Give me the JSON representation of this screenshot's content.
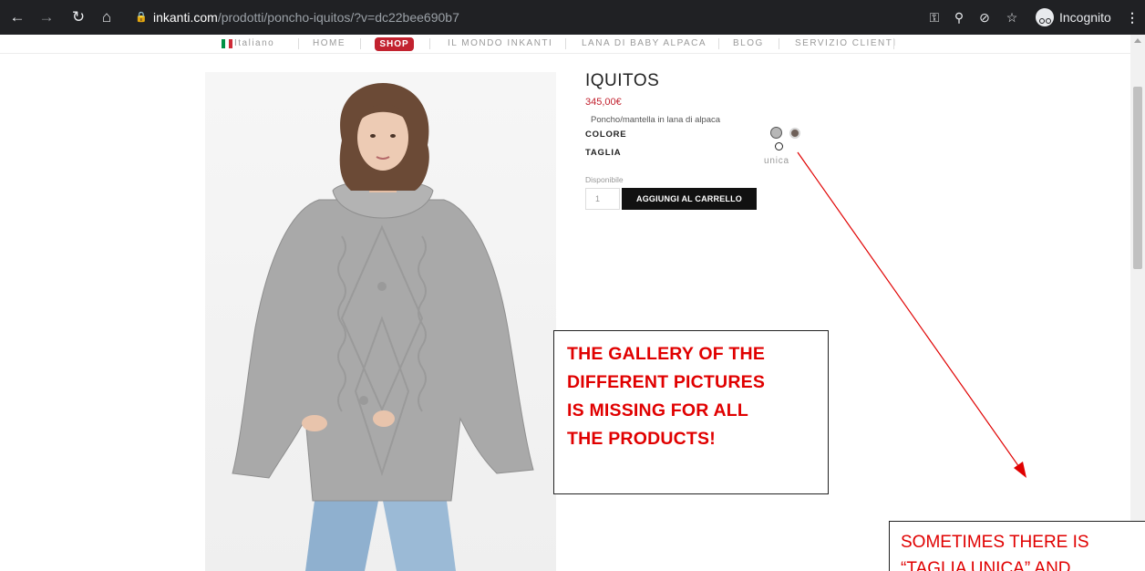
{
  "browser": {
    "url_domain": "inkanti.com",
    "url_path": "/prodotti/poncho-iquitos/?v=dc22bee690b7",
    "incognito_label": "Incognito",
    "icons": [
      "back-icon",
      "forward-icon",
      "reload-icon",
      "home-icon",
      "lock-icon",
      "key-icon",
      "zoom-icon",
      "eye-off-icon",
      "star-icon",
      "incognito-icon",
      "menu-icon"
    ]
  },
  "nav": {
    "language": "Italiano",
    "items": [
      "HOME",
      "SHOP",
      "IL MONDO INKANTI",
      "LANA DI BABY ALPACA",
      "BLOG",
      "SERVIZIO CLIENTI"
    ],
    "active_color": "#c2222f"
  },
  "product": {
    "title": "IQUITOS",
    "price": "345,00€",
    "description": "Poncho/mantella in lana di alpaca",
    "color_label": "COLORE",
    "size_label": "TAGLIA",
    "size_value": "unica",
    "availability": "Disponibile",
    "quantity": "1",
    "add_to_cart": "AGGIUNGI AL CARRELLO",
    "colors": [
      "#b7b7b7",
      "#6e6059"
    ]
  },
  "annotations": {
    "note1": [
      "THE GALLERY OF THE",
      "DIFFERENT PICTURES",
      "IS MISSING FOR ALL",
      "THE PRODUCTS!"
    ],
    "note2": [
      "SOMETIMES THERE IS",
      "“TAGLIA UNICA” AND"
    ],
    "color": "#e00000"
  }
}
